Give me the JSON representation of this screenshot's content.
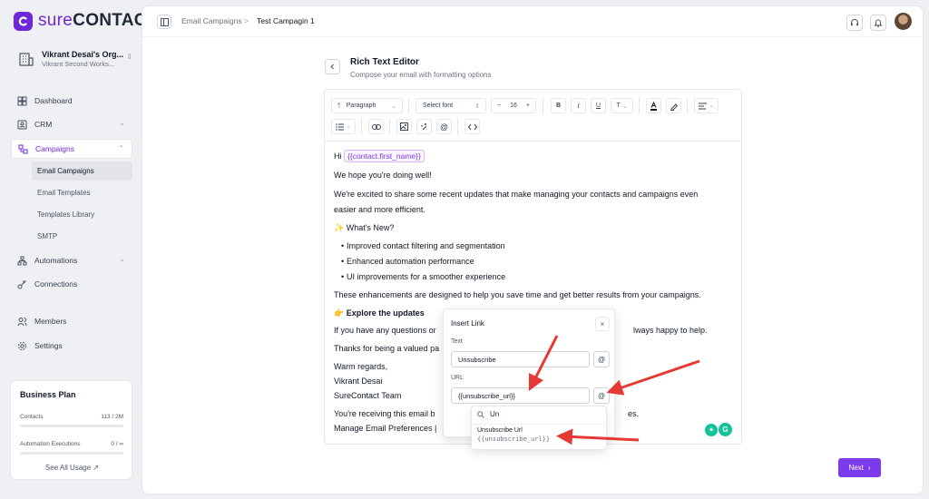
{
  "brand": {
    "logo_text_sure": "sure",
    "logo_text_contact": "CONTACT"
  },
  "org": {
    "name": "Vikrant Desai's Org...",
    "workspace": "Vikrant Second Works..."
  },
  "nav": {
    "dashboard": "Dashboard",
    "crm": "CRM",
    "campaigns": "Campaigns",
    "campaigns_sub": [
      "Email Campaigns",
      "Email Templates",
      "Templates Library",
      "SMTP"
    ],
    "automations": "Automations",
    "connections": "Connections",
    "members": "Members",
    "settings": "Settings"
  },
  "plan": {
    "title": "Business Plan",
    "contacts_label": "Contacts",
    "contacts_value": "113 / 2M",
    "automation_label": "Automation Executions",
    "automation_value": "0 / ∞",
    "see_all": "See All Usage ↗"
  },
  "breadcrumb": {
    "parent": "Email Campaigns",
    "separator": ">",
    "current": "Test Campagin 1"
  },
  "editor_header": {
    "title": "Rich Text Editor",
    "subtitle": "Compose your email with formatting options"
  },
  "toolbar": {
    "paragraph": "Paragraph",
    "font": "Select font",
    "size": "16",
    "minus": "−",
    "plus": "+",
    "bold": "B",
    "italic": "I",
    "underline": "U",
    "text": "T"
  },
  "email": {
    "hi": "Hi",
    "tag_first_name": "{{contact.first_name}}",
    "line1": "We hope you're doing well!",
    "line2a": "We're excited to share some recent updates that make managing your contacts and campaigns even",
    "line2b": "easier and more efficient.",
    "whats_new": "✨ What's New?",
    "bullets": [
      "Improved contact filtering and segmentation",
      "Enhanced automation performance",
      "UI improvements for a smoother experience"
    ],
    "line3": "These enhancements are designed to help you save time and get better results from your campaigns.",
    "explore": "Explore the updates",
    "explore_emoji": "👉",
    "questions_a": "If you have any questions or",
    "questions_b": "lways happy to help.",
    "thanks": "Thanks for being a valued pa",
    "regards": "Warm regards,",
    "name": "Vikrant Desai",
    "team": "SureContact Team",
    "receiving_a": "You're receiving this email b",
    "receiving_b": "es.",
    "manage": "Manage Email Preferences |"
  },
  "insert_link": {
    "title": "Insert Link",
    "close": "×",
    "text_label": "Text",
    "text_value": "Unsubscribe",
    "url_label": "URL",
    "url_value": "{{unsubscribe_url}}",
    "at": "@"
  },
  "dropdown": {
    "search_value": "Un",
    "item_title": "Unsubscribe Url",
    "item_tag": "{{unsubscribe_url}}"
  },
  "grammarly_letter": "G",
  "next_button": "Next",
  "next_chevron": "›",
  "colors": {
    "accent": "#7c3aed",
    "arrow": "#e53935"
  }
}
